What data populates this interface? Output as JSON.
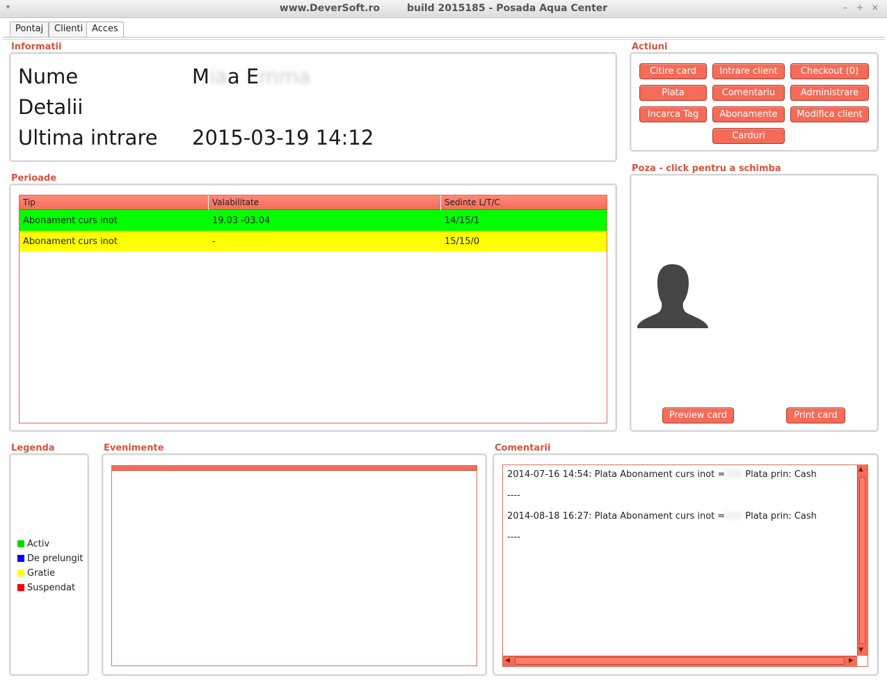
{
  "window": {
    "title": "www.DeverSoft.ro        build 2015185 - Posada Aqua Center",
    "menu_glyph": "▾",
    "minimize_glyph": "–",
    "maximize_glyph": "+",
    "close_glyph": "×"
  },
  "tabs": [
    {
      "label": "Pontaj",
      "active": false
    },
    {
      "label": "Clienti",
      "active": false
    },
    {
      "label": "Acces",
      "active": true
    }
  ],
  "informatii": {
    "title": "Informatii",
    "name_label": "Nume",
    "name_value_a": "M",
    "name_value_b": "ia",
    "name_value_c": "a E",
    "name_value_d": "mma",
    "details_label": "Detalii",
    "details_value": "",
    "last_entry_label": "Ultima intrare",
    "last_entry_value": "2015-03-19 14:12"
  },
  "actiuni": {
    "title": "Actiuni",
    "buttons": [
      "Citire card",
      "Intrare client",
      "Checkout (0)",
      "Plata",
      "Comentariu",
      "Administrare",
      "Incarca Tag",
      "Abonamente",
      "Modifica client",
      "Carduri"
    ]
  },
  "perioade": {
    "title": "Perioade",
    "columns": [
      "Tip",
      "Valabilitate",
      "Sedinte L/T/C"
    ],
    "rows": [
      {
        "tip": "Abonament curs inot",
        "valabilitate": "19.03 -03.04",
        "sedinte": "14/15/1",
        "color": "#00ff00"
      },
      {
        "tip": "Abonament curs inot",
        "valabilitate": "-",
        "sedinte": "15/15/0",
        "color": "#ffff00"
      }
    ]
  },
  "poza": {
    "title": "Poza - click pentru a schimba",
    "preview_button": "Preview card",
    "print_button": "Print card"
  },
  "legenda": {
    "title": "Legenda",
    "items": [
      {
        "label": "Activ",
        "color": "#00dd00"
      },
      {
        "label": "De prelungit",
        "color": "#0000ff"
      },
      {
        "label": "Gratie",
        "color": "#ffff00"
      },
      {
        "label": "Suspendat",
        "color": "#ff0000"
      }
    ]
  },
  "evenimente": {
    "title": "Evenimente"
  },
  "comentarii": {
    "title": "Comentarii",
    "lines": [
      {
        "a": "2014-07-16 14:54: Plata Abonament curs inot =",
        "b": "200",
        "c": " Plata prin: Cash"
      },
      {
        "a": "----"
      },
      {
        "a": "2014-08-18 16:27: Plata Abonament curs inot =",
        "b": "200",
        "c": " Plata prin: Cash"
      },
      {
        "a": "----"
      }
    ]
  },
  "colors": {
    "accent": "#d9523c",
    "button": "#f56b58",
    "active": "#00ff00",
    "grace": "#ffff00"
  }
}
